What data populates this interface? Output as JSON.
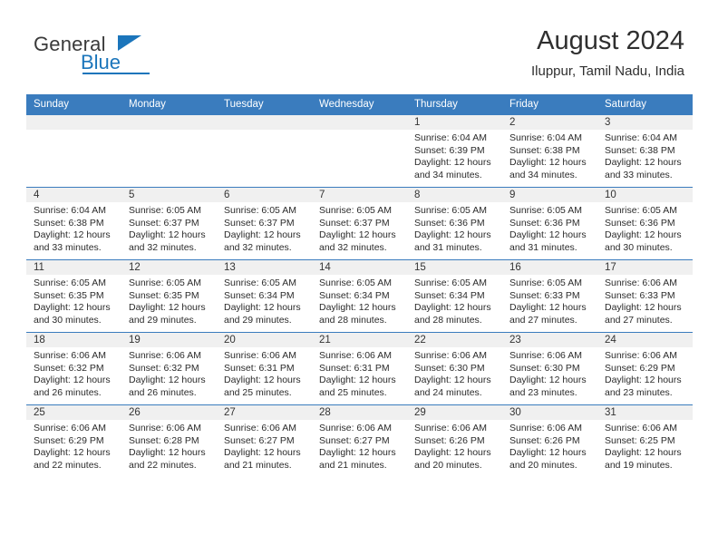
{
  "brand": {
    "name_part1": "General",
    "name_part2": "Blue",
    "accent_color": "#1b75bb"
  },
  "header": {
    "month_title": "August 2024",
    "location": "Iluppur, Tamil Nadu, India"
  },
  "calendar": {
    "header_color": "#3a7cbe",
    "daynum_bg": "#f0f0f0",
    "weekdays": [
      "Sunday",
      "Monday",
      "Tuesday",
      "Wednesday",
      "Thursday",
      "Friday",
      "Saturday"
    ],
    "weeks": [
      [
        {
          "day": "",
          "empty": true
        },
        {
          "day": "",
          "empty": true
        },
        {
          "day": "",
          "empty": true
        },
        {
          "day": "",
          "empty": true
        },
        {
          "day": "1",
          "sunrise": "Sunrise: 6:04 AM",
          "sunset": "Sunset: 6:39 PM",
          "daylight_line1": "Daylight: 12 hours",
          "daylight_line2": "and 34 minutes."
        },
        {
          "day": "2",
          "sunrise": "Sunrise: 6:04 AM",
          "sunset": "Sunset: 6:38 PM",
          "daylight_line1": "Daylight: 12 hours",
          "daylight_line2": "and 34 minutes."
        },
        {
          "day": "3",
          "sunrise": "Sunrise: 6:04 AM",
          "sunset": "Sunset: 6:38 PM",
          "daylight_line1": "Daylight: 12 hours",
          "daylight_line2": "and 33 minutes."
        }
      ],
      [
        {
          "day": "4",
          "sunrise": "Sunrise: 6:04 AM",
          "sunset": "Sunset: 6:38 PM",
          "daylight_line1": "Daylight: 12 hours",
          "daylight_line2": "and 33 minutes."
        },
        {
          "day": "5",
          "sunrise": "Sunrise: 6:05 AM",
          "sunset": "Sunset: 6:37 PM",
          "daylight_line1": "Daylight: 12 hours",
          "daylight_line2": "and 32 minutes."
        },
        {
          "day": "6",
          "sunrise": "Sunrise: 6:05 AM",
          "sunset": "Sunset: 6:37 PM",
          "daylight_line1": "Daylight: 12 hours",
          "daylight_line2": "and 32 minutes."
        },
        {
          "day": "7",
          "sunrise": "Sunrise: 6:05 AM",
          "sunset": "Sunset: 6:37 PM",
          "daylight_line1": "Daylight: 12 hours",
          "daylight_line2": "and 32 minutes."
        },
        {
          "day": "8",
          "sunrise": "Sunrise: 6:05 AM",
          "sunset": "Sunset: 6:36 PM",
          "daylight_line1": "Daylight: 12 hours",
          "daylight_line2": "and 31 minutes."
        },
        {
          "day": "9",
          "sunrise": "Sunrise: 6:05 AM",
          "sunset": "Sunset: 6:36 PM",
          "daylight_line1": "Daylight: 12 hours",
          "daylight_line2": "and 31 minutes."
        },
        {
          "day": "10",
          "sunrise": "Sunrise: 6:05 AM",
          "sunset": "Sunset: 6:36 PM",
          "daylight_line1": "Daylight: 12 hours",
          "daylight_line2": "and 30 minutes."
        }
      ],
      [
        {
          "day": "11",
          "sunrise": "Sunrise: 6:05 AM",
          "sunset": "Sunset: 6:35 PM",
          "daylight_line1": "Daylight: 12 hours",
          "daylight_line2": "and 30 minutes."
        },
        {
          "day": "12",
          "sunrise": "Sunrise: 6:05 AM",
          "sunset": "Sunset: 6:35 PM",
          "daylight_line1": "Daylight: 12 hours",
          "daylight_line2": "and 29 minutes."
        },
        {
          "day": "13",
          "sunrise": "Sunrise: 6:05 AM",
          "sunset": "Sunset: 6:34 PM",
          "daylight_line1": "Daylight: 12 hours",
          "daylight_line2": "and 29 minutes."
        },
        {
          "day": "14",
          "sunrise": "Sunrise: 6:05 AM",
          "sunset": "Sunset: 6:34 PM",
          "daylight_line1": "Daylight: 12 hours",
          "daylight_line2": "and 28 minutes."
        },
        {
          "day": "15",
          "sunrise": "Sunrise: 6:05 AM",
          "sunset": "Sunset: 6:34 PM",
          "daylight_line1": "Daylight: 12 hours",
          "daylight_line2": "and 28 minutes."
        },
        {
          "day": "16",
          "sunrise": "Sunrise: 6:05 AM",
          "sunset": "Sunset: 6:33 PM",
          "daylight_line1": "Daylight: 12 hours",
          "daylight_line2": "and 27 minutes."
        },
        {
          "day": "17",
          "sunrise": "Sunrise: 6:06 AM",
          "sunset": "Sunset: 6:33 PM",
          "daylight_line1": "Daylight: 12 hours",
          "daylight_line2": "and 27 minutes."
        }
      ],
      [
        {
          "day": "18",
          "sunrise": "Sunrise: 6:06 AM",
          "sunset": "Sunset: 6:32 PM",
          "daylight_line1": "Daylight: 12 hours",
          "daylight_line2": "and 26 minutes."
        },
        {
          "day": "19",
          "sunrise": "Sunrise: 6:06 AM",
          "sunset": "Sunset: 6:32 PM",
          "daylight_line1": "Daylight: 12 hours",
          "daylight_line2": "and 26 minutes."
        },
        {
          "day": "20",
          "sunrise": "Sunrise: 6:06 AM",
          "sunset": "Sunset: 6:31 PM",
          "daylight_line1": "Daylight: 12 hours",
          "daylight_line2": "and 25 minutes."
        },
        {
          "day": "21",
          "sunrise": "Sunrise: 6:06 AM",
          "sunset": "Sunset: 6:31 PM",
          "daylight_line1": "Daylight: 12 hours",
          "daylight_line2": "and 25 minutes."
        },
        {
          "day": "22",
          "sunrise": "Sunrise: 6:06 AM",
          "sunset": "Sunset: 6:30 PM",
          "daylight_line1": "Daylight: 12 hours",
          "daylight_line2": "and 24 minutes."
        },
        {
          "day": "23",
          "sunrise": "Sunrise: 6:06 AM",
          "sunset": "Sunset: 6:30 PM",
          "daylight_line1": "Daylight: 12 hours",
          "daylight_line2": "and 23 minutes."
        },
        {
          "day": "24",
          "sunrise": "Sunrise: 6:06 AM",
          "sunset": "Sunset: 6:29 PM",
          "daylight_line1": "Daylight: 12 hours",
          "daylight_line2": "and 23 minutes."
        }
      ],
      [
        {
          "day": "25",
          "sunrise": "Sunrise: 6:06 AM",
          "sunset": "Sunset: 6:29 PM",
          "daylight_line1": "Daylight: 12 hours",
          "daylight_line2": "and 22 minutes."
        },
        {
          "day": "26",
          "sunrise": "Sunrise: 6:06 AM",
          "sunset": "Sunset: 6:28 PM",
          "daylight_line1": "Daylight: 12 hours",
          "daylight_line2": "and 22 minutes."
        },
        {
          "day": "27",
          "sunrise": "Sunrise: 6:06 AM",
          "sunset": "Sunset: 6:27 PM",
          "daylight_line1": "Daylight: 12 hours",
          "daylight_line2": "and 21 minutes."
        },
        {
          "day": "28",
          "sunrise": "Sunrise: 6:06 AM",
          "sunset": "Sunset: 6:27 PM",
          "daylight_line1": "Daylight: 12 hours",
          "daylight_line2": "and 21 minutes."
        },
        {
          "day": "29",
          "sunrise": "Sunrise: 6:06 AM",
          "sunset": "Sunset: 6:26 PM",
          "daylight_line1": "Daylight: 12 hours",
          "daylight_line2": "and 20 minutes."
        },
        {
          "day": "30",
          "sunrise": "Sunrise: 6:06 AM",
          "sunset": "Sunset: 6:26 PM",
          "daylight_line1": "Daylight: 12 hours",
          "daylight_line2": "and 20 minutes."
        },
        {
          "day": "31",
          "sunrise": "Sunrise: 6:06 AM",
          "sunset": "Sunset: 6:25 PM",
          "daylight_line1": "Daylight: 12 hours",
          "daylight_line2": "and 19 minutes."
        }
      ]
    ]
  }
}
